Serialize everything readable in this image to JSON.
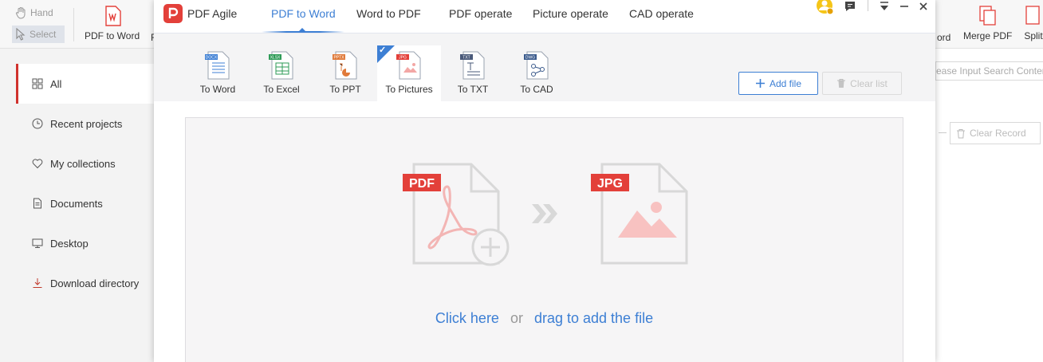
{
  "background": {
    "toolbar": {
      "hand_label": "Hand",
      "select_label": "Select",
      "pdf_to_word_label": "PDF to Word",
      "partial_left": "F",
      "partial_ord": "ord",
      "merge_pdf_label": "Merge PDF",
      "split_label": "Split"
    },
    "nav": [
      {
        "label": "All",
        "icon": "grid-icon"
      },
      {
        "label": "Recent projects",
        "icon": "clock-icon"
      },
      {
        "label": "My collections",
        "icon": "heart-icon"
      },
      {
        "label": "Documents",
        "icon": "document-icon"
      },
      {
        "label": "Desktop",
        "icon": "monitor-icon"
      },
      {
        "label": "Download directory",
        "icon": "download-icon"
      }
    ],
    "search_placeholder": "ease Input Search Content",
    "clear_record_label": "Clear Record"
  },
  "dialog": {
    "app_name": "PDF Agile",
    "tabs": [
      {
        "label": "PDF to Word",
        "active": true
      },
      {
        "label": "Word to PDF",
        "active": false
      },
      {
        "label": "PDF operate",
        "active": false
      },
      {
        "label": "Picture operate",
        "active": false
      },
      {
        "label": "CAD operate",
        "active": false
      }
    ],
    "sub_tabs": [
      {
        "label": "To Word",
        "badge": "DOCX",
        "color": "#3d7fd4",
        "active": false
      },
      {
        "label": "To Excel",
        "badge": "XLSX",
        "color": "#2e9b57",
        "active": false
      },
      {
        "label": "To PPT",
        "badge": "PPTX",
        "color": "#e07a3a",
        "active": false
      },
      {
        "label": "To Pictures",
        "badge": "JPG",
        "color": "#e3403a",
        "active": true
      },
      {
        "label": "To TXT",
        "badge": "TXT",
        "color": "#4a5a7a",
        "active": false
      },
      {
        "label": "To CAD",
        "badge": "DWG",
        "color": "#3a5a8c",
        "active": false
      }
    ],
    "add_file_label": "Add file",
    "clear_list_label": "Clear list",
    "drop": {
      "source_badge": "PDF",
      "target_badge": "JPG",
      "click_here": "Click here",
      "or": "or",
      "drag_text": "drag to add the file"
    },
    "accent_color": "#3d7fd4",
    "brand_color": "#e3403a"
  }
}
